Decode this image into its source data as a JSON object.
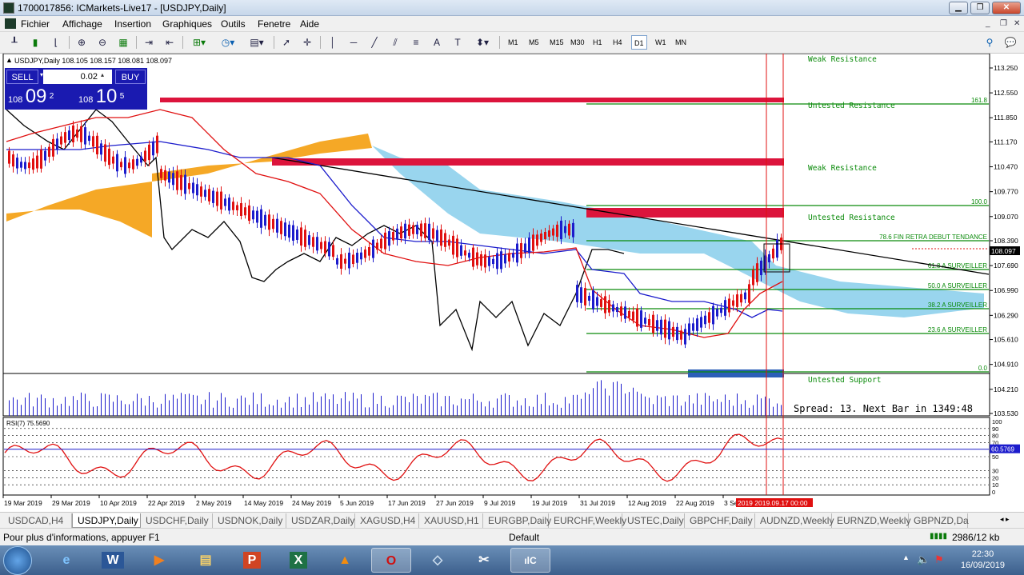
{
  "window": {
    "title": "1700017856: ICMarkets-Live17 - [USDJPY,Daily]"
  },
  "menu": {
    "items": [
      "Fichier",
      "Affichage",
      "Insertion",
      "Graphiques",
      "Outils",
      "Fenetre",
      "Aide"
    ]
  },
  "toolbar": {
    "timeframes": [
      "M1",
      "M5",
      "M15",
      "M30",
      "H1",
      "H4",
      "D1",
      "W1",
      "MN"
    ],
    "active_timeframe": "D1",
    "text_tool": "A"
  },
  "chart_header": {
    "symbol_info": "USDJPY,Daily  108.105 108.157 108.081 108.097"
  },
  "trade_panel": {
    "sell_label": "SELL",
    "buy_label": "BUY",
    "lot_value": "0.02",
    "sell_price_small": "108",
    "sell_price_big": "09",
    "sell_price_sup": "2",
    "buy_price_small": "108",
    "buy_price_big": "10",
    "buy_price_sup": "5"
  },
  "price_axis": {
    "ticks": [
      "113.250",
      "112.550",
      "111.850",
      "111.170",
      "110.470",
      "109.770",
      "109.070",
      "108.390",
      "107.690",
      "106.990",
      "106.290",
      "105.610",
      "104.910",
      "104.210",
      "103.530"
    ],
    "current_price": "108.097"
  },
  "time_axis": {
    "labels": [
      "19 Mar 2019",
      "29 Mar 2019",
      "10 Apr 2019",
      "22 Apr 2019",
      "2 May 2019",
      "14 May 2019",
      "24 May 2019",
      "5 Jun 2019",
      "17 Jun 2019",
      "27 Jun 2019",
      "9 Jul 2019",
      "19 Jul 2019",
      "31 Jul 2019",
      "12 Aug 2019",
      "22 Aug 2019",
      "3 Se"
    ],
    "cursor_labels": [
      "2019",
      "2019.09.17 00:00"
    ]
  },
  "annotations": {
    "weak_resistance_1": "Weak Resistance",
    "untested_resistance_1": "Untested Resistance",
    "weak_resistance_2": "Weak Resistance",
    "untested_resistance_2": "Untested Resistance",
    "untested_support": "Untested Support",
    "spread": "Spread: 13. Next Bar in 1349:48"
  },
  "fibonacci": {
    "levels": [
      "161.8",
      "100.0",
      "78.6 FIN RETRA DEBUT TENDANCE",
      "61.8 A SURVEILLER",
      "50.0 A SURVEILLER",
      "38.2 A SURVEILLER",
      "23.6 A SURVEILLER",
      "0.0"
    ]
  },
  "rsi": {
    "label": "RSI(7) 75.5690",
    "current_value": "60.5769",
    "scale": [
      "100",
      "90",
      "80",
      "70",
      "50",
      "30",
      "20",
      "10",
      "0"
    ]
  },
  "tabs": [
    "USDCAD,H4",
    "USDJPY,Daily",
    "USDCHF,Daily",
    "USDNOK,Daily",
    "USDZAR,Daily",
    "XAGUSD,H4",
    "XAUUSD,H1",
    "EURGBP,Daily",
    "EURCHF,Weekly",
    "USTEC,Daily",
    "GBPCHF,Daily",
    "AUDNZD,Weekly",
    "EURNZD,Weekly",
    "GBPNZD,Da"
  ],
  "active_tab": "USDJPY,Daily",
  "status": {
    "help": "Pour plus d'informations, appuyer F1",
    "profile": "Default",
    "traffic": "2986/12 kb"
  },
  "taskbar": {
    "time": "22:30",
    "date": "16/09/2019"
  },
  "colors": {
    "bull_candle": "#1c1ccc",
    "bear_candle": "#e01010",
    "cloud_bull": "#f4a31a",
    "cloud_bear": "#87ceeb",
    "zone": "#dc143c",
    "fib": "#0a8a0a",
    "background": "#ffffff"
  }
}
